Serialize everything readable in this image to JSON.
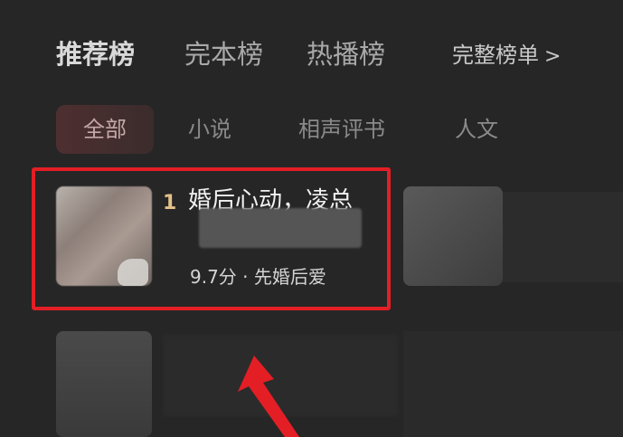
{
  "rank_tabs": [
    {
      "label": "推荐榜",
      "active": true
    },
    {
      "label": "完本榜",
      "active": false
    },
    {
      "label": "热播榜",
      "active": false
    }
  ],
  "full_list": {
    "label": "完整榜单",
    "chevron": ">"
  },
  "categories": [
    {
      "label": "全部",
      "active": true
    },
    {
      "label": "小说",
      "active": false
    },
    {
      "label": "相声评书",
      "active": false
    },
    {
      "label": "人文",
      "active": false
    }
  ],
  "highlighted_item": {
    "rank": "1",
    "title": "婚后心动，凌总",
    "meta": "9.7分 · 先婚后爱"
  },
  "colors": {
    "highlight_border": "#e41e25",
    "arrow": "#e41e25",
    "rank_number": "#e2c08a"
  }
}
